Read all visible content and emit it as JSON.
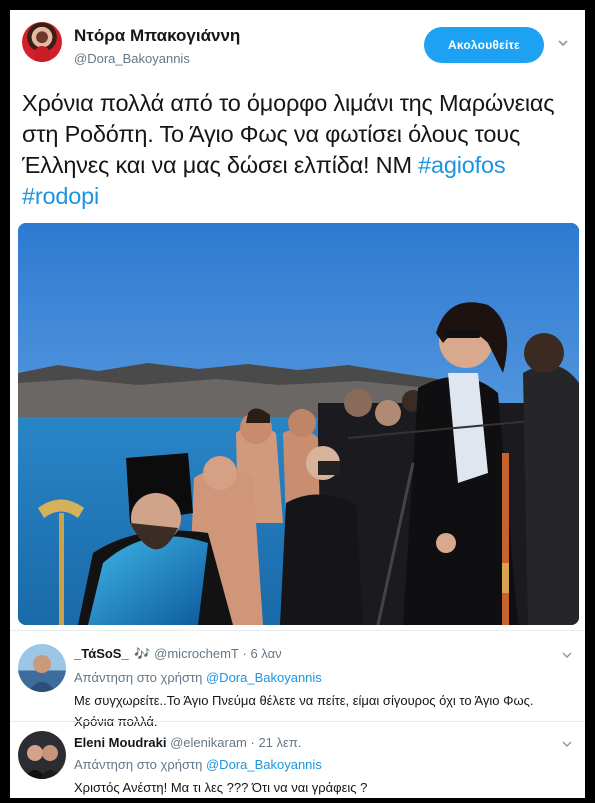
{
  "author": {
    "name": "Ντόρα Μπακογιάννη",
    "handle": "@Dora_Bakoyannis"
  },
  "follow_label": "Ακολουθείτε",
  "tweet": {
    "text_before": "Χρόνια πολλά από το όμορφο λιμάνι της Μαρώνειας στη Ροδόπη. Το Άγιο Φως να φωτίσει όλους τους Έλληνες και να μας δώσει ελπίδα! ΝΜ ",
    "hashtag1": "#agiofos",
    "hashtag2": "#rodopi"
  },
  "replies": [
    {
      "name": "_ΤάSoS_",
      "name_suffix": "🎶",
      "handle": "@microchemT",
      "time": "6 λαν",
      "reply_to_prefix": "Απάντηση στο χρήστη",
      "reply_to_handle": "@Dora_Bakoyannis",
      "text": "Με συγχωρείτε..Το Άγιο Πνεύμα θέλετε να πείτε, είμαι σίγουρος όχι το Άγιο Φως. Χρόνια πολλά."
    },
    {
      "name": "Eleni Moudraki",
      "handle": "@elenikaram",
      "time": "21 λεπ.",
      "reply_to_prefix": "Απάντηση στο χρήστη",
      "reply_to_handle": "@Dora_Bakoyannis",
      "text": "Χριστός Ανέστη! Μα τι λες ??? Ότι να ναι γράφεις ?"
    }
  ],
  "colors": {
    "accent": "#1da1f2",
    "link": "#1b95e0",
    "text": "#14171a",
    "muted": "#657786"
  }
}
